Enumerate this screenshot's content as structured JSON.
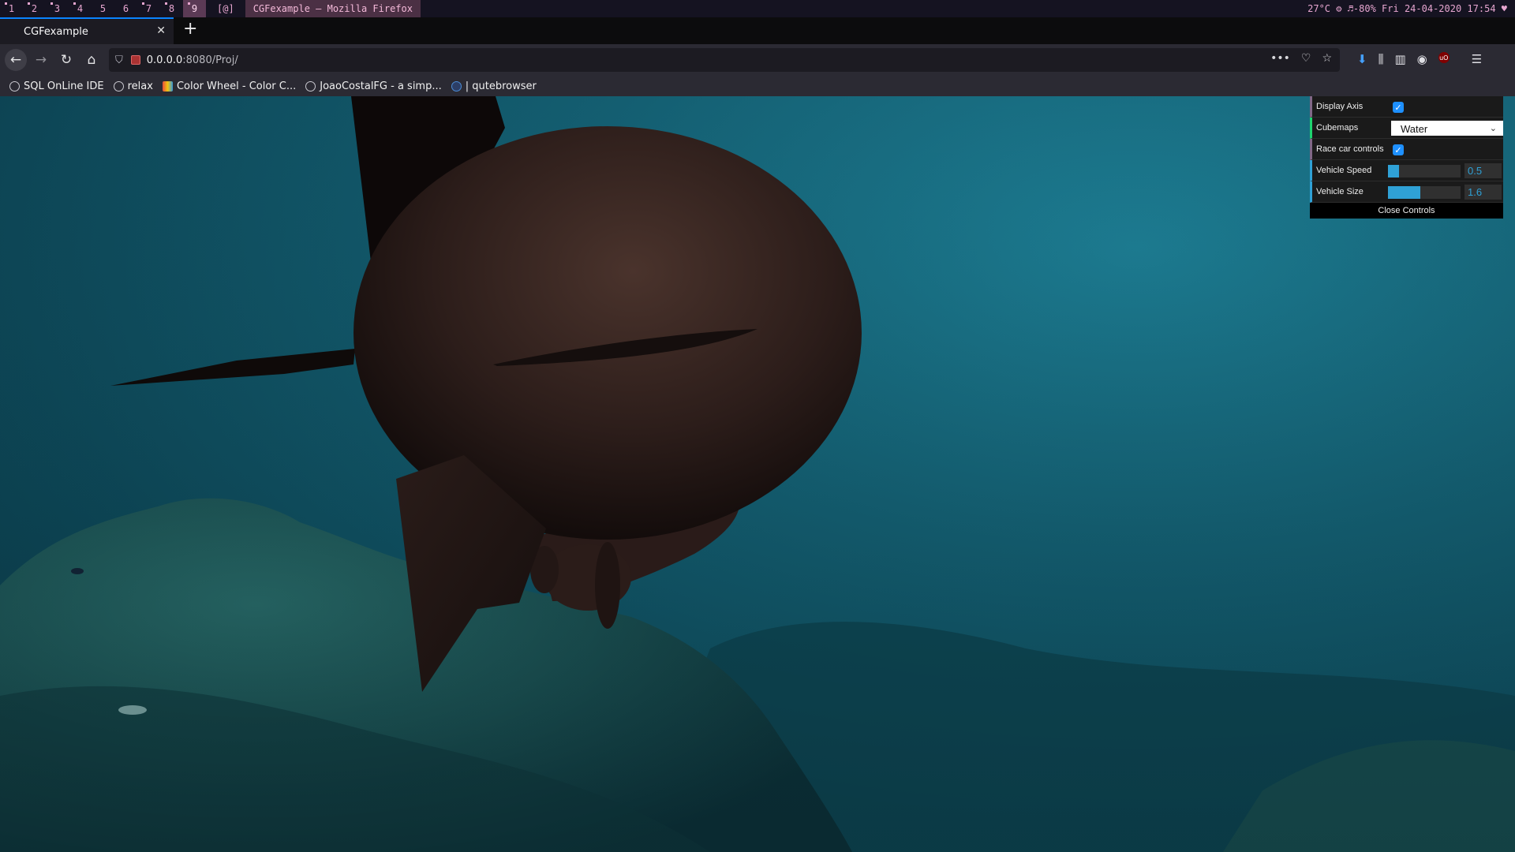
{
  "wm": {
    "workspaces": [
      "1",
      "2",
      "3",
      "4",
      "5",
      "6",
      "7",
      "8",
      "9"
    ],
    "active_workspace": "9",
    "float_tag": "[@]",
    "window_title": "CGFexample – Mozilla Firefox",
    "status": "27°C ⚙ ♬-80% Fri 24-04-2020 17:54 ♥"
  },
  "browser": {
    "tab_title": "CGFexample",
    "url_host": "0.0.0.0",
    "url_path": ":8080/Proj/",
    "bookmarks": [
      {
        "label": "SQL OnLine IDE",
        "icon": "globe-icon"
      },
      {
        "label": "relax",
        "icon": "globe-icon"
      },
      {
        "label": "Color Wheel - Color C...",
        "icon": "color-wheel-icon"
      },
      {
        "label": "JoaoCostalFG - a simp...",
        "icon": "globe-icon"
      },
      {
        "label": "| qutebrowser",
        "icon": "qutebrowser-icon"
      }
    ]
  },
  "gui": {
    "display_axis_label": "Display Axis",
    "display_axis": true,
    "cubemaps_label": "Cubemaps",
    "cubemaps_value": "Water",
    "race_label": "Race car controls",
    "race": true,
    "speed_label": "Vehicle Speed",
    "speed_value": "0.5",
    "speed_fraction": 0.15,
    "size_label": "Vehicle Size",
    "size_value": "1.6",
    "size_fraction": 0.45,
    "close_label": "Close Controls"
  },
  "colors": {
    "accent": "#0a84ff",
    "gui_number": "#2fa1d6",
    "gui_boolean": "#806787",
    "gui_option": "#1ed36f"
  }
}
